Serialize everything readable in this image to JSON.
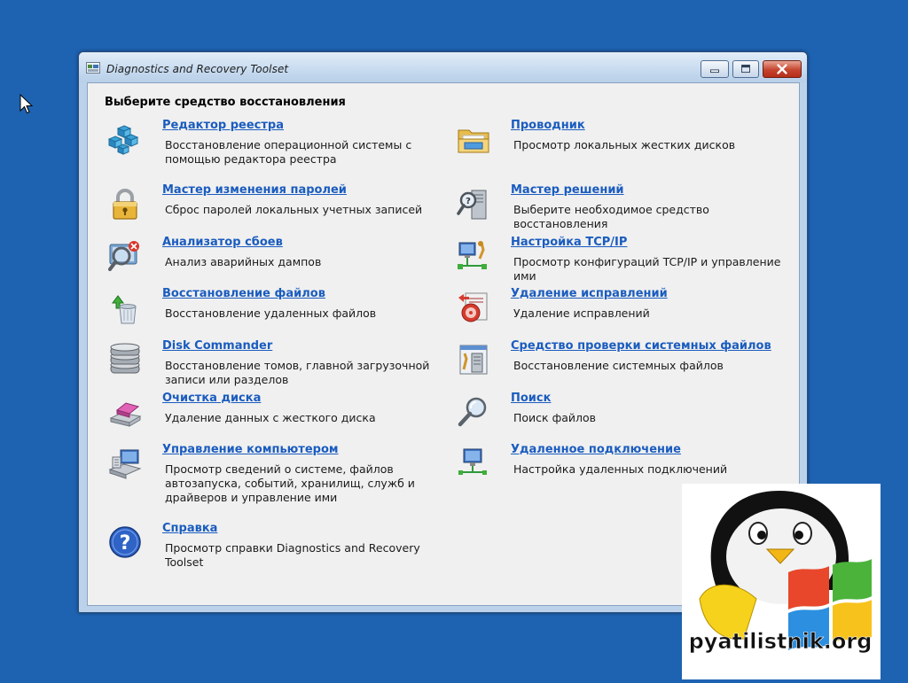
{
  "window": {
    "title": "Diagnostics and Recovery Toolset"
  },
  "heading": "Выберите средство восстановления",
  "tools_left": [
    {
      "icon": "registry-editor-icon",
      "link": "Редактор реестра",
      "desc": "Восстановление операционной системы с помощью редактора реестра"
    },
    {
      "icon": "padlock-icon",
      "link": "Мастер изменения паролей",
      "desc": "Сброс паролей локальных учетных записей"
    },
    {
      "icon": "crash-analyzer-icon",
      "link": "Анализатор сбоев",
      "desc": "Анализ аварийных дампов"
    },
    {
      "icon": "file-restore-icon",
      "link": "Восстановление файлов",
      "desc": "Восстановление удаленных файлов"
    },
    {
      "icon": "disk-stack-icon",
      "link": "Disk Commander",
      "desc": "Восстановление томов, главной загрузочной записи или разделов"
    },
    {
      "icon": "disk-wipe-icon",
      "link": "Очистка диска",
      "desc": "Удаление данных с жесткого диска"
    },
    {
      "icon": "computer-management-icon",
      "link": "Управление компьютером",
      "desc": "Просмотр сведений о системе, файлов автозапуска, событий, хранилищ, служб и драйверов и управление ими"
    },
    {
      "icon": "help-icon",
      "link": "Справка",
      "desc": "Просмотр справки Diagnostics and Recovery Toolset"
    }
  ],
  "tools_right": [
    {
      "icon": "folder-explorer-icon",
      "link": "Проводник",
      "desc": "Просмотр локальных жестких дисков"
    },
    {
      "icon": "solution-wizard-icon",
      "link": "Мастер решений",
      "desc": "Выберите необходимое средство восстановления"
    },
    {
      "icon": "network-settings-icon",
      "link": "Настройка TCP/IP",
      "desc": "Просмотр конфигураций TCP/IP и управление ими"
    },
    {
      "icon": "hotfix-uninstall-icon",
      "link": "Удаление исправлений",
      "desc": "Удаление исправлений"
    },
    {
      "icon": "system-file-checker-icon",
      "link": "Средство проверки системных файлов",
      "desc": "Восстановление системных файлов"
    },
    {
      "icon": "magnifier-icon",
      "link": "Поиск",
      "desc": "Поиск файлов"
    },
    {
      "icon": "remote-connection-icon",
      "link": "Удаленное подключение",
      "desc": "Настройка удаленных подключений"
    }
  ],
  "watermark": {
    "text": "pyatilistnik.org"
  },
  "colors": {
    "desktop": "#1e63b1",
    "link": "#1a5cbf",
    "panel": "#f0f0f0",
    "frame": "#bcd2ea"
  }
}
